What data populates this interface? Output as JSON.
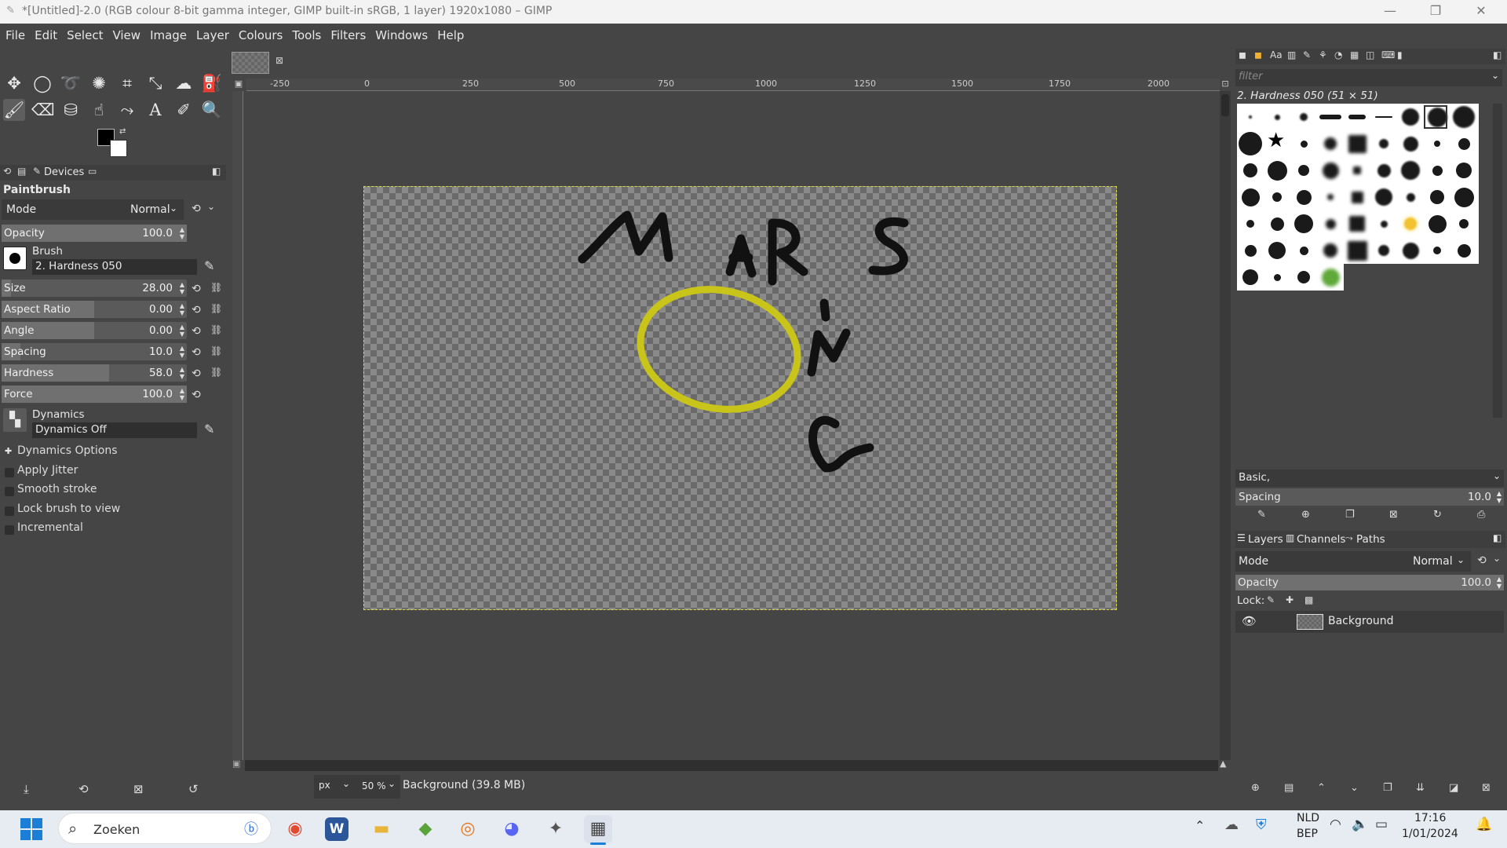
{
  "window": {
    "title": "*[Untitled]-2.0 (RGB colour 8-bit gamma integer, GIMP built-in sRGB, 1 layer) 1920x1080 – GIMP"
  },
  "menu": [
    "File",
    "Edit",
    "Select",
    "View",
    "Image",
    "Layer",
    "Colours",
    "Tools",
    "Filters",
    "Windows",
    "Help"
  ],
  "tool_options": {
    "tab_devices": "Devices",
    "tool_name": "Paintbrush",
    "mode_label": "Mode",
    "mode_value": "Normal",
    "opacity": {
      "label": "Opacity",
      "value": "100.0"
    },
    "brush_label": "Brush",
    "brush_value": "2. Hardness 050",
    "size": {
      "label": "Size",
      "value": "28.00",
      "fraction": 0.05
    },
    "aspect": {
      "label": "Aspect Ratio",
      "value": "0.00",
      "fraction": 0.5
    },
    "angle": {
      "label": "Angle",
      "value": "0.00",
      "fraction": 0.5
    },
    "spacing": {
      "label": "Spacing",
      "value": "10.0",
      "fraction": 0.1
    },
    "hardness": {
      "label": "Hardness",
      "value": "58.0",
      "fraction": 0.58
    },
    "force": {
      "label": "Force",
      "value": "100.0",
      "fraction": 1
    },
    "dynamics_label": "Dynamics",
    "dynamics_value": "Dynamics Off",
    "dynamics_options": "Dynamics Options",
    "apply_jitter": "Apply Jitter",
    "smooth_stroke": "Smooth stroke",
    "lock_brush": "Lock brush to view",
    "incremental": "Incremental"
  },
  "rulers": {
    "h": [
      "-250",
      "0",
      "250",
      "500",
      "750",
      "1000",
      "1250",
      "1500",
      "1750",
      "2000"
    ]
  },
  "canvas": {
    "drawn_text": "MARS ING",
    "stroke_color": "#111111",
    "ring_color": "#c9c41a"
  },
  "status": {
    "unit": "px",
    "zoom": "50 %",
    "info": "Background (39.8 MB)"
  },
  "brushes": {
    "filter_placeholder": "filter",
    "title": "2. Hardness 050 (51 × 51)",
    "tag": "Basic,",
    "spacing_label": "Spacing",
    "spacing_value": "10.0"
  },
  "layers": {
    "tab_layers": "Layers",
    "tab_channels": "Channels",
    "tab_paths": "Paths",
    "mode_label": "Mode",
    "mode_value": "Normal",
    "opacity_label": "Opacity",
    "opacity_value": "100.0",
    "lock_label": "Lock:",
    "layer_name": "Background"
  },
  "taskbar": {
    "search": "Zoeken",
    "lang1": "NLD",
    "lang2": "BEP",
    "time": "17:16",
    "date": "1/01/2024"
  }
}
